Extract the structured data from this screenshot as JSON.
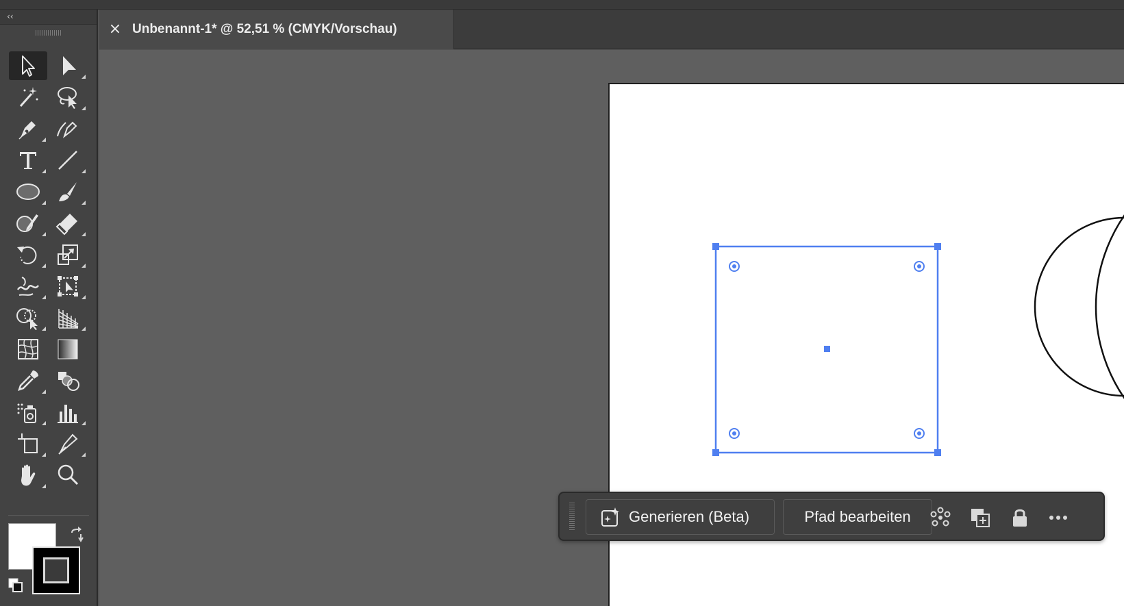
{
  "document_tab": {
    "title": "Unbenannt-1* @ 52,51 % (CMYK/Vorschau)",
    "close_symbol": "×"
  },
  "toolbar": {
    "collapse_symbol": "‹‹",
    "tools": [
      {
        "name": "selection-tool",
        "icon": "arrow-icon",
        "active": true
      },
      {
        "name": "direct-selection-tool",
        "icon": "direct-arrow-icon"
      },
      {
        "name": "magic-wand-tool",
        "icon": "magic-wand-icon"
      },
      {
        "name": "lasso-tool",
        "icon": "lasso-icon"
      },
      {
        "name": "pen-tool",
        "icon": "pen-icon"
      },
      {
        "name": "curvature-tool",
        "icon": "curvature-pen-icon"
      },
      {
        "name": "type-tool",
        "icon": "type-icon"
      },
      {
        "name": "line-segment-tool",
        "icon": "line-icon"
      },
      {
        "name": "ellipse-tool",
        "icon": "ellipse-icon"
      },
      {
        "name": "paintbrush-tool",
        "icon": "brush-icon"
      },
      {
        "name": "shaper-tool",
        "icon": "shaper-icon"
      },
      {
        "name": "eraser-tool",
        "icon": "eraser-icon"
      },
      {
        "name": "rotate-tool",
        "icon": "rotate-icon"
      },
      {
        "name": "scale-tool",
        "icon": "scale-icon"
      },
      {
        "name": "warp-tool",
        "icon": "warp-icon"
      },
      {
        "name": "free-transform-tool",
        "icon": "free-transform-icon"
      },
      {
        "name": "shape-builder-tool",
        "icon": "shape-builder-icon"
      },
      {
        "name": "perspective-grid-tool",
        "icon": "perspective-grid-icon"
      },
      {
        "name": "mesh-tool",
        "icon": "mesh-icon"
      },
      {
        "name": "gradient-tool",
        "icon": "gradient-icon"
      },
      {
        "name": "eyedropper-tool",
        "icon": "eyedropper-icon"
      },
      {
        "name": "blend-tool",
        "icon": "blend-icon"
      },
      {
        "name": "symbol-sprayer-tool",
        "icon": "symbol-sprayer-icon"
      },
      {
        "name": "column-graph-tool",
        "icon": "graph-icon"
      },
      {
        "name": "artboard-tool",
        "icon": "artboard-icon"
      },
      {
        "name": "slice-tool",
        "icon": "slice-icon"
      },
      {
        "name": "hand-tool",
        "icon": "hand-icon"
      },
      {
        "name": "zoom-tool",
        "icon": "zoom-icon"
      }
    ],
    "fill_color": "#ffffff",
    "stroke_color": "#000000"
  },
  "taskbar": {
    "generate_label": "Generieren (Beta)",
    "edit_path_label": "Pfad bearbeiten",
    "icons": [
      "recolor-points-icon",
      "duplicate-icon",
      "lock-icon",
      "more-options-icon"
    ]
  },
  "colors": {
    "selection": "#4f7ff0",
    "canvas_bg": "#5f5f5f",
    "panel_bg": "#434343"
  }
}
